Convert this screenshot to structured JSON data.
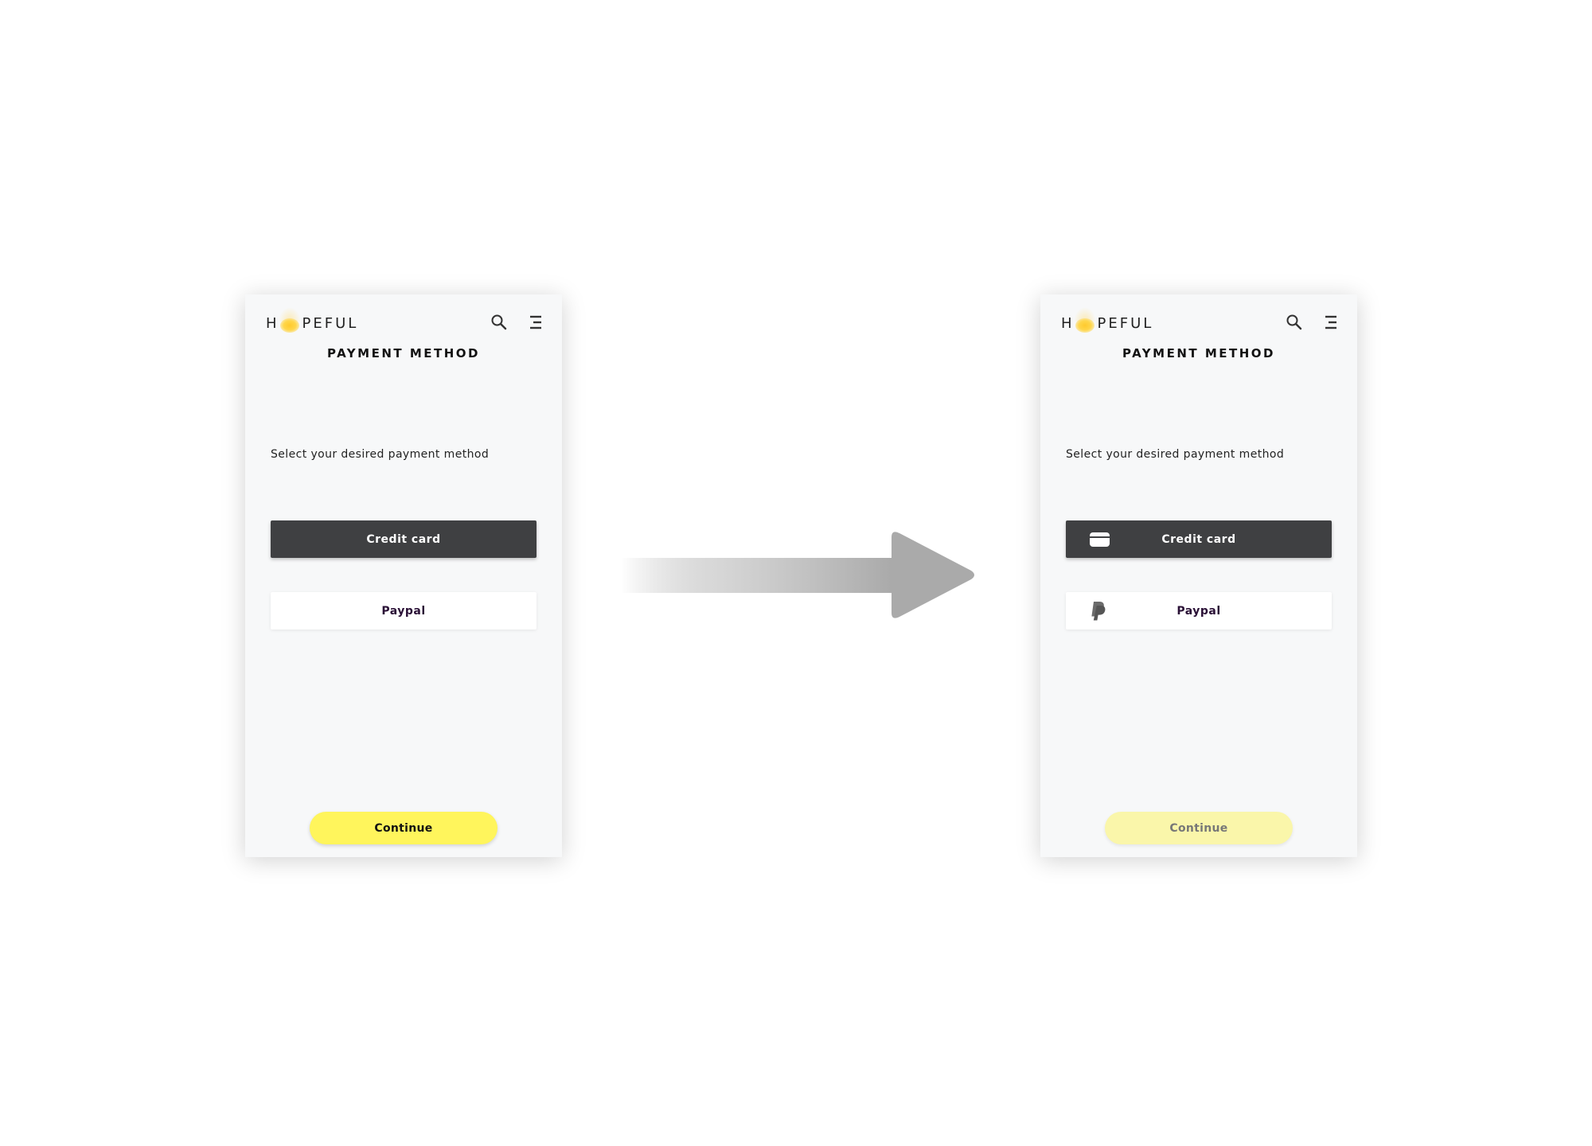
{
  "before": {
    "logo": {
      "left": "H",
      "right": "PEFUL"
    },
    "title": "PAYMENT METHOD",
    "prompt": "Select your desired payment method",
    "credit_card_label": "Credit card",
    "paypal_label": "Paypal",
    "continue_label": "Continue",
    "continue_state": "enabled"
  },
  "after": {
    "logo": {
      "left": "H",
      "right": "PEFUL"
    },
    "title": "PAYMENT METHOD",
    "prompt": "Select your desired payment method",
    "credit_card_label": "Credit card",
    "credit_card_icon": "credit-card-icon",
    "paypal_label": "Paypal",
    "paypal_icon": "paypal-icon",
    "continue_label": "Continue",
    "continue_state": "disabled"
  },
  "icons": {
    "search": "search-icon",
    "menu": "menu-icon",
    "transition": "right-arrow-icon"
  },
  "colors": {
    "screen_background": "#f7f8f9",
    "credit_card_button": "#3f4042",
    "paypal_button": "#ffffff",
    "continue_active": "#fff55c",
    "continue_disabled": "#faf6aa",
    "logo_sun": "#ffca2e",
    "arrow": "#aaaaaa"
  }
}
